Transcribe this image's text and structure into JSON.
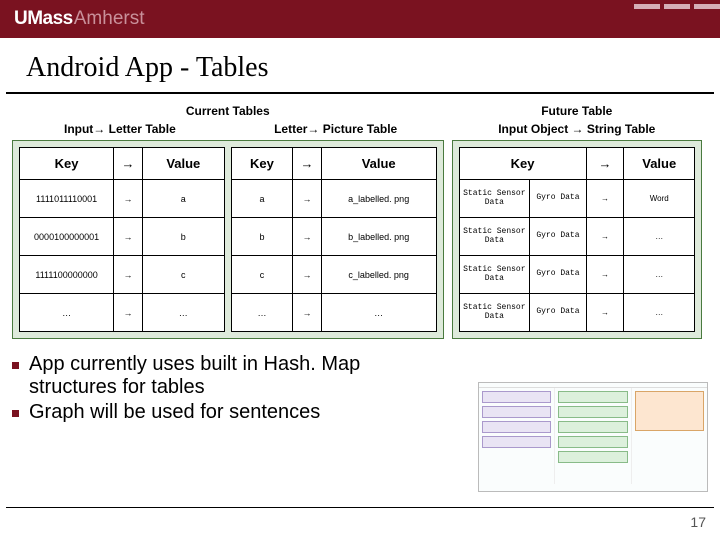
{
  "brand": {
    "part1": "UMass",
    "part2": "Amherst"
  },
  "title": "Android App - Tables",
  "groups": {
    "current": {
      "label": "Current Tables"
    },
    "future": {
      "label": "Future Table"
    }
  },
  "tables": {
    "input_letter": {
      "label": "Input→ Letter Table",
      "head": {
        "key": "Key",
        "value": "Value"
      },
      "rows": [
        {
          "key": "1111011110001",
          "value": "a"
        },
        {
          "key": "0000100000001",
          "value": "b"
        },
        {
          "key": "1111100000000",
          "value": "c"
        },
        {
          "key": "…",
          "value": "…"
        }
      ]
    },
    "letter_picture": {
      "label": "Letter→ Picture Table",
      "head": {
        "key": "Key",
        "value": "Value"
      },
      "rows": [
        {
          "key": "a",
          "value": "a_labelled. png"
        },
        {
          "key": "b",
          "value": "b_labelled. png"
        },
        {
          "key": "c",
          "value": "c_labelled. png"
        },
        {
          "key": "…",
          "value": "…"
        }
      ]
    },
    "input_object_string": {
      "label": "Input Object → String Table",
      "head": {
        "key": "Key",
        "value": "Value"
      },
      "rows": [
        {
          "k1": "Static Sensor Data",
          "k2": "Gyro Data",
          "value": "Word"
        },
        {
          "k1": "Static Sensor Data",
          "k2": "Gyro Data",
          "value": "…"
        },
        {
          "k1": "Static Sensor Data",
          "k2": "Gyro Data",
          "value": "…"
        },
        {
          "k1": "Static Sensor Data",
          "k2": "Gyro Data",
          "value": "…"
        }
      ]
    }
  },
  "arrow": "→",
  "bullets": [
    "App currently uses built in Hash. Map structures for tables",
    "Graph will be used for sentences"
  ],
  "page_number": "17",
  "chart_data": {
    "type": "table",
    "tables": [
      {
        "name": "Input→ Letter Table",
        "columns": [
          "Key",
          "Value"
        ],
        "rows": [
          [
            "1111011110001",
            "a"
          ],
          [
            "0000100000001",
            "b"
          ],
          [
            "1111100000000",
            "c"
          ],
          [
            "…",
            "…"
          ]
        ]
      },
      {
        "name": "Letter→ Picture Table",
        "columns": [
          "Key",
          "Value"
        ],
        "rows": [
          [
            "a",
            "a_labelled. png"
          ],
          [
            "b",
            "b_labelled. png"
          ],
          [
            "c",
            "c_labelled. png"
          ],
          [
            "…",
            "…"
          ]
        ]
      },
      {
        "name": "Input Object → String Table",
        "columns": [
          "Key",
          "Value"
        ],
        "rows": [
          [
            "Static Sensor Data + Gyro Data",
            "Word"
          ],
          [
            "Static Sensor Data + Gyro Data",
            "…"
          ],
          [
            "Static Sensor Data + Gyro Data",
            "…"
          ],
          [
            "Static Sensor Data + Gyro Data",
            "…"
          ]
        ]
      }
    ]
  }
}
